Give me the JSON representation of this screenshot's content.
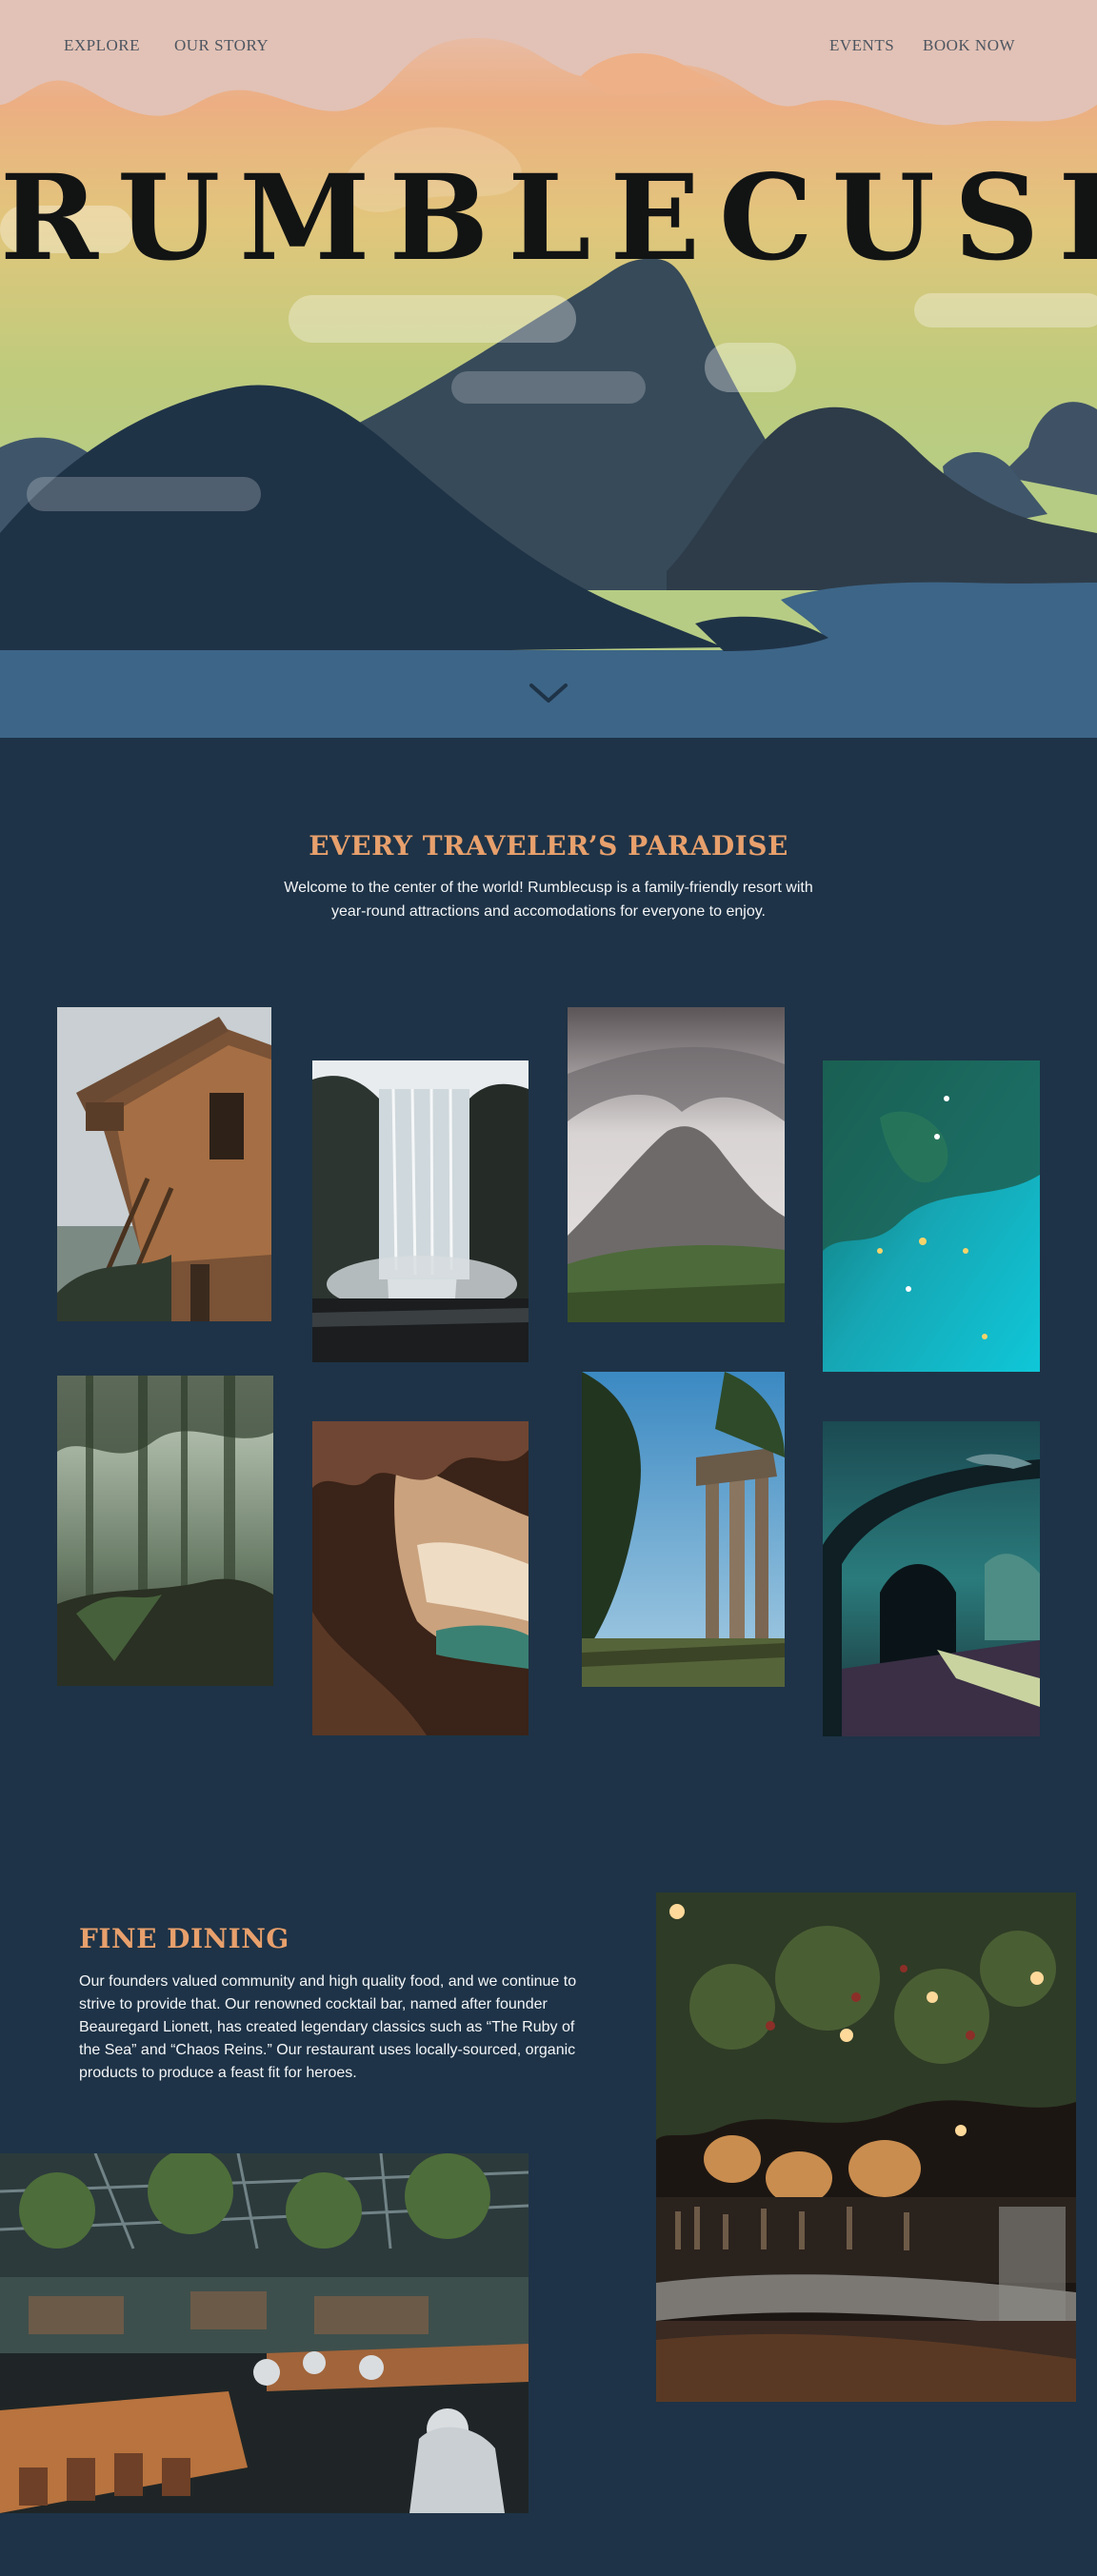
{
  "nav": {
    "explore": "EXPLORE",
    "our_story": "OUR STORY",
    "events": "EVENTS",
    "book_now": "BOOK NOW"
  },
  "hero": {
    "brand": "RUMBLECUSP",
    "scroll_icon": "chevron-down-icon"
  },
  "paradise": {
    "title": "EVERY TRAVELER’S PARADISE",
    "text": "Welcome to the center of the world! Rumblecusp is a family-friendly resort with year-round attractions and accomodations for everyone to enjoy."
  },
  "gallery": [
    "treehouse-photo",
    "waterfall-photo",
    "volcano-photo",
    "snorkeling-photo",
    "rainforest-photo",
    "cave-photo",
    "ruins-photo",
    "aquarium-photo"
  ],
  "dining": {
    "title": "FINE DINING",
    "text": "Our founders valued community and high quality food, and we continue to strive to provide that. Our renowned cocktail bar, named after founder Beauregard Lionett, has created legendary classics such as “The Ruby of the Sea” and “Chaos Reins.” Our restaurant uses locally-sourced, organic products to produce a feast fit for heroes."
  },
  "colors": {
    "background": "#1e3347",
    "accent": "#e8a06c",
    "text": "#f3f5f7"
  }
}
